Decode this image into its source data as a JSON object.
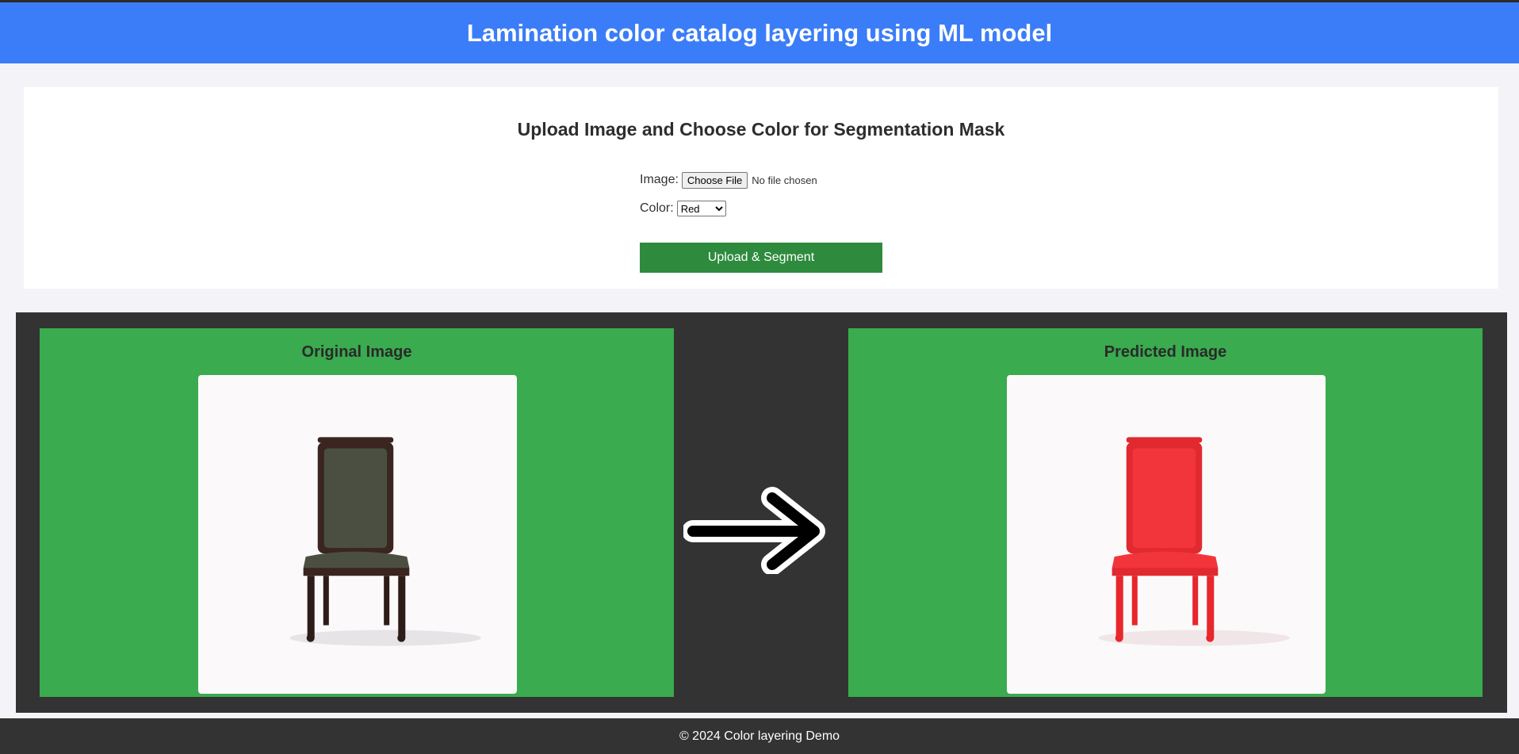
{
  "header": {
    "title": "Lamination color catalog layering using ML model"
  },
  "upload": {
    "heading": "Upload Image and Choose Color for Segmentation Mask",
    "image_label": "Image:",
    "file_button": "Choose File",
    "file_status": "No file chosen",
    "color_label": "Color:",
    "color_selected": "Red",
    "submit_label": "Upload & Segment"
  },
  "results": {
    "original_title": "Original Image",
    "predicted_title": "Predicted Image"
  },
  "colors": {
    "header_bg": "#3b7df8",
    "submit_bg": "#2e8b3e",
    "panel_bg": "#3aab4e",
    "results_bg": "#333333",
    "original_chair": "#4a4f42",
    "predicted_chair": "#f2353a"
  },
  "footer": {
    "text": "© 2024 Color layering Demo"
  }
}
